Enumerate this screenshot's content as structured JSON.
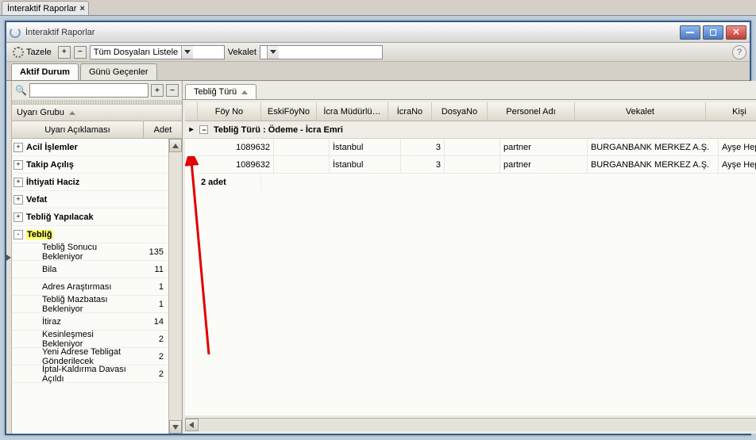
{
  "outerTab": {
    "label": "İnteraktif Raporlar"
  },
  "window": {
    "title": "İnteraktif Raporlar"
  },
  "toolbar": {
    "refresh": "Tazele",
    "fileFilter": "Tüm Dosyaları Listele",
    "vekaletLabel": "Vekalet",
    "vekaletValue": ""
  },
  "mainTabs": {
    "active": "Aktif Durum",
    "other": "Günü Geçenler"
  },
  "left": {
    "searchPlaceholder": "",
    "groupPanel": "Uyarı Grubu",
    "col1": "Uyarı Açıklaması",
    "col2": "Adet",
    "rows": [
      {
        "type": "group",
        "exp": "+",
        "label": "Acil İşlemler",
        "count": ""
      },
      {
        "type": "group",
        "exp": "+",
        "label": "Takip Açılış",
        "count": ""
      },
      {
        "type": "group",
        "exp": "+",
        "label": "İhtiyati Haciz",
        "count": ""
      },
      {
        "type": "group",
        "exp": "+",
        "label": "Vefat",
        "count": ""
      },
      {
        "type": "group",
        "exp": "+",
        "label": "Tebliğ Yapılacak",
        "count": ""
      },
      {
        "type": "group",
        "exp": "-",
        "label": "Tebliğ",
        "count": "",
        "hl": true
      },
      {
        "type": "child",
        "label": "Tebliğ Sonucu Bekleniyor",
        "count": "135"
      },
      {
        "type": "child",
        "label": "Bila",
        "count": "11"
      },
      {
        "type": "child",
        "label": "Adres Araştırması",
        "count": "1"
      },
      {
        "type": "child",
        "label": "Tebliğ Mazbatası Bekleniyor",
        "count": "1"
      },
      {
        "type": "child",
        "label": "İtiraz",
        "count": "14"
      },
      {
        "type": "child",
        "label": "Kesinleşmesi Bekleniyor",
        "count": "2"
      },
      {
        "type": "child",
        "label": "Yeni Adrese Tebligat Gönderilecek",
        "count": "2"
      },
      {
        "type": "child",
        "label": "İptal-Kaldırma Davası Açıldı",
        "count": "2"
      }
    ]
  },
  "right": {
    "tab": "Tebliğ Türü",
    "headers": {
      "foy": "Föy No",
      "eski": "EskiFöyNo",
      "mud": "İcra Müdürlü…",
      "ino": "İcraNo",
      "dosya": "DosyaNo",
      "personel": "Personel Adı",
      "vekalet": "Vekalet",
      "kisi": "Kişi"
    },
    "groupRow": "Tebliğ Türü : Ödeme - İcra Emri",
    "rows": [
      {
        "foy": "1089632",
        "eski": "",
        "mud": "İstanbul",
        "ino": "3",
        "dosya": "",
        "per": "partner",
        "vek": "BURGANBANK MERKEZ A.Ş.",
        "kisi": "Ayşe Hepgüle"
      },
      {
        "foy": "1089632",
        "eski": "",
        "mud": "İstanbul",
        "ino": "3",
        "dosya": "",
        "per": "partner",
        "vek": "BURGANBANK MERKEZ A.Ş.",
        "kisi": "Ayşe Hepgüle"
      }
    ],
    "summary": "2 adet"
  }
}
